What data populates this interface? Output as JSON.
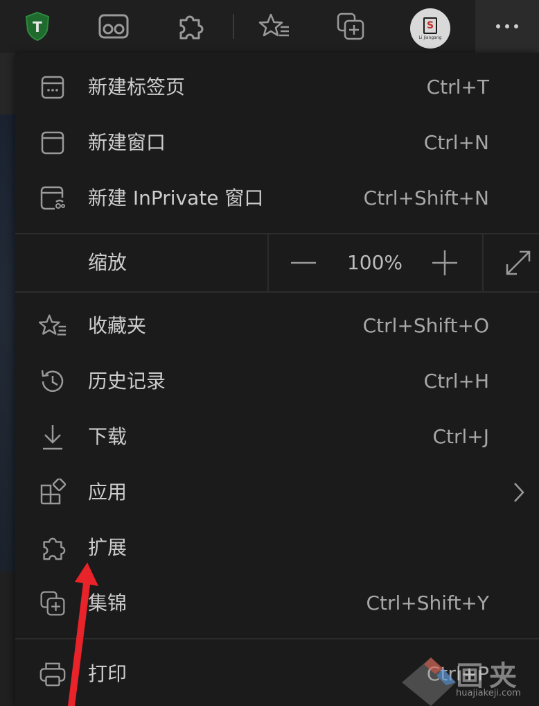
{
  "menu": {
    "items": [
      {
        "label": "新建标签页",
        "shortcut": "Ctrl+T",
        "icon": "new-tab-icon"
      },
      {
        "label": "新建窗口",
        "shortcut": "Ctrl+N",
        "icon": "new-window-icon"
      },
      {
        "label": "新建 InPrivate 窗口",
        "shortcut": "Ctrl+Shift+N",
        "icon": "inprivate-window-icon"
      },
      {
        "label": "收藏夹",
        "shortcut": "Ctrl+Shift+O",
        "icon": "favorites-icon"
      },
      {
        "label": "历史记录",
        "shortcut": "Ctrl+H",
        "icon": "history-icon"
      },
      {
        "label": "下载",
        "shortcut": "Ctrl+J",
        "icon": "download-icon"
      },
      {
        "label": "应用",
        "shortcut": "",
        "icon": "apps-icon"
      },
      {
        "label": "扩展",
        "shortcut": "",
        "icon": "extensions-icon"
      },
      {
        "label": "集锦",
        "shortcut": "Ctrl+Shift+Y",
        "icon": "collections-icon"
      },
      {
        "label": "打印",
        "shortcut": "Ctrl+P",
        "icon": "print-icon"
      }
    ],
    "zoom": {
      "label": "缩放",
      "value": "100%"
    }
  },
  "toolbar": {
    "avatar_letter": "S",
    "avatar_caption": "Li Jiangang"
  },
  "watermark": {
    "text": "画夹",
    "url": "huajiakeji.com"
  },
  "colors": {
    "menu_bg": "#1b1b1b",
    "toolbar_bg": "#1f1f1f",
    "annotation_arrow": "#e8232a",
    "shield_green": "#1f6b2e"
  }
}
